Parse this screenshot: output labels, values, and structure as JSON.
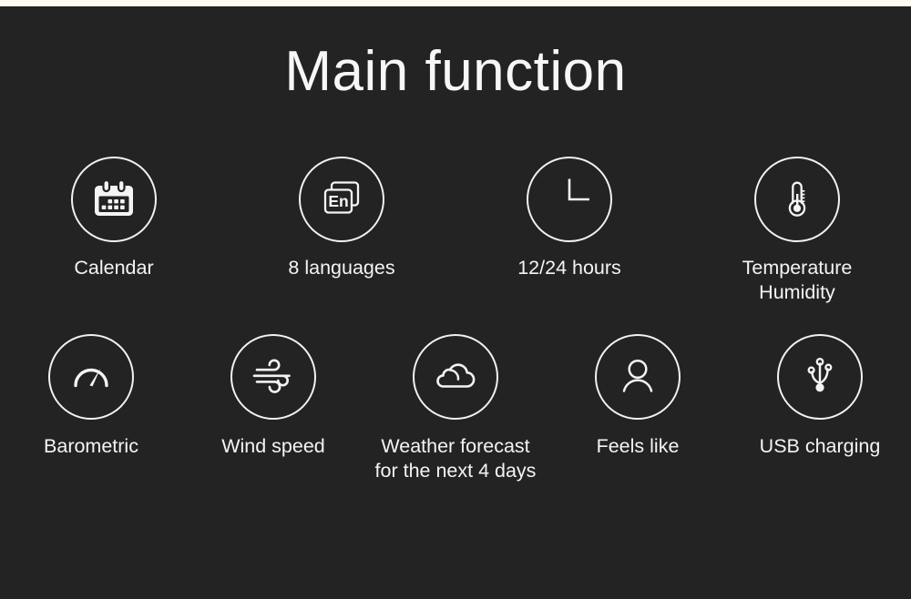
{
  "theme": {
    "background": "#232323",
    "foreground": "#f4f4f4",
    "top_strip": "#fdfaf2"
  },
  "header": {
    "title": "Main function"
  },
  "features": {
    "row_1": [
      {
        "icon": "calendar-icon",
        "label": "Calendar"
      },
      {
        "icon": "languages-icon",
        "label": "8 languages",
        "icon_text": "En"
      },
      {
        "icon": "clock-icon",
        "label": "12/24 hours"
      },
      {
        "icon": "thermometer-icon",
        "label": "Temperature\nHumidity"
      }
    ],
    "row_2": [
      {
        "icon": "barometer-icon",
        "label": "Barometric"
      },
      {
        "icon": "wind-icon",
        "label": "Wind speed"
      },
      {
        "icon": "cloud-icon",
        "label": "Weather forecast\nfor the next 4 days"
      },
      {
        "icon": "person-icon",
        "label": "Feels like"
      },
      {
        "icon": "usb-icon",
        "label": "USB charging"
      }
    ]
  }
}
